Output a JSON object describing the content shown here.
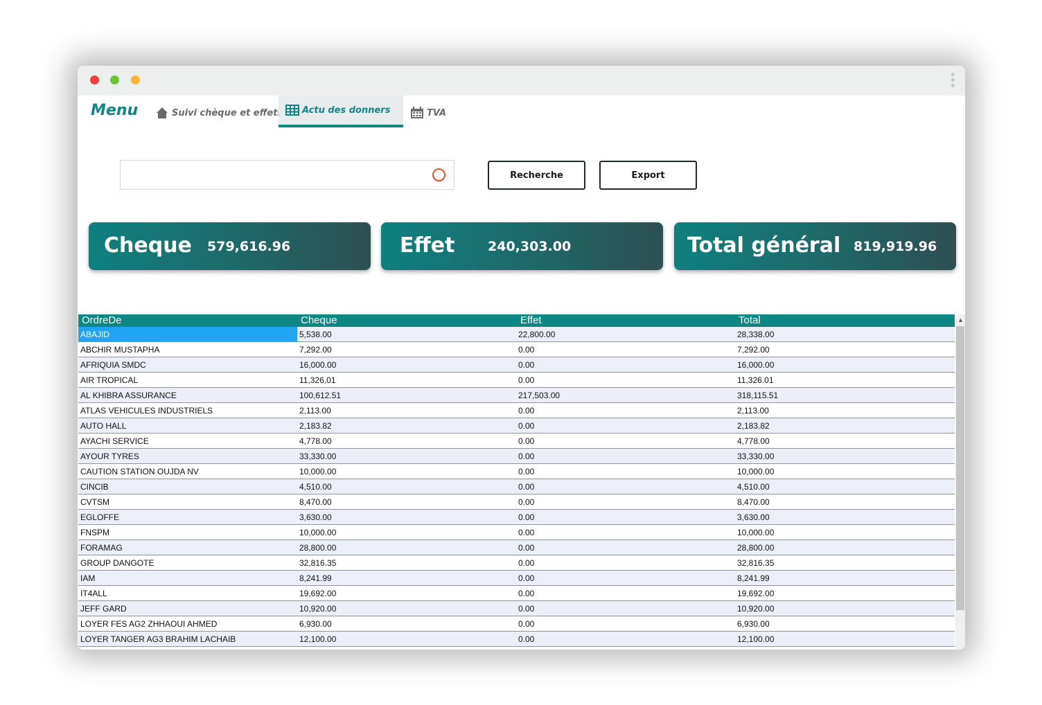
{
  "window": {
    "controls": [
      "close",
      "minimize",
      "maximize"
    ]
  },
  "nav": {
    "menu_label": "Menu",
    "tabs": [
      {
        "label": "Suivi chèque et effets",
        "icon": "home-icon",
        "active": false
      },
      {
        "label": "Actu des donners",
        "icon": "table-icon",
        "active": true
      },
      {
        "label": "TVA",
        "icon": "calendar-icon",
        "active": false
      }
    ]
  },
  "search": {
    "value": "",
    "placeholder": ""
  },
  "buttons": {
    "search_label": "Recherche",
    "export_label": "Export"
  },
  "cards": [
    {
      "label": "Cheque",
      "value": "579,616.96"
    },
    {
      "label": "Effet",
      "value": "240,303.00"
    },
    {
      "label": "Total général",
      "value": "819,919.96"
    }
  ],
  "colors": {
    "accent": "#0e8784",
    "card_gradient_end": "#2e4f52",
    "selection": "#20a4f3"
  },
  "table": {
    "columns": [
      "OrdreDe",
      "Cheque",
      "Effet",
      "Total"
    ],
    "rows": [
      [
        "ABAJID",
        "5,538.00",
        "22,800.00",
        "28,338.00"
      ],
      [
        "ABCHIR MUSTAPHA",
        "7,292.00",
        "0.00",
        "7,292.00"
      ],
      [
        "AFRIQUIA SMDC",
        "16,000.00",
        "0.00",
        "16,000.00"
      ],
      [
        "AIR TROPICAL",
        "11,326.01",
        "0.00",
        "11,326.01"
      ],
      [
        "AL KHIBRA ASSURANCE",
        "100,612.51",
        "217,503.00",
        "318,115.51"
      ],
      [
        "ATLAS VEHICULES INDUSTRIELS",
        "2,113.00",
        "0.00",
        "2,113.00"
      ],
      [
        "AUTO HALL",
        "2,183.82",
        "0.00",
        "2,183.82"
      ],
      [
        "AYACHI SERVICE",
        "4,778.00",
        "0.00",
        "4,778.00"
      ],
      [
        "AYOUR TYRES",
        "33,330.00",
        "0.00",
        "33,330.00"
      ],
      [
        "CAUTION STATION OUJDA NV",
        "10,000.00",
        "0.00",
        "10,000.00"
      ],
      [
        "CINCIB",
        "4,510.00",
        "0.00",
        "4,510.00"
      ],
      [
        "CVTSM",
        "8,470.00",
        "0.00",
        "8,470.00"
      ],
      [
        "EGLOFFE",
        "3,630.00",
        "0.00",
        "3,630.00"
      ],
      [
        "FNSPM",
        "10,000.00",
        "0.00",
        "10,000.00"
      ],
      [
        "FORAMAG",
        "28,800.00",
        "0.00",
        "28,800.00"
      ],
      [
        "GROUP DANGOTE",
        "32,816.35",
        "0.00",
        "32,816.35"
      ],
      [
        "IAM",
        "8,241.99",
        "0.00",
        "8,241.99"
      ],
      [
        "IT4ALL",
        "19,692.00",
        "0.00",
        "19,692.00"
      ],
      [
        "JEFF GARD",
        "10,920.00",
        "0.00",
        "10,920.00"
      ],
      [
        "LOYER FES AG2 ZHHAOUI AHMED",
        "6,930.00",
        "0.00",
        "6,930.00"
      ],
      [
        "LOYER TANGER AG3 BRAHIM LACHAIB",
        "12,100.00",
        "0.00",
        "12,100.00"
      ]
    ],
    "selected_row": 0
  }
}
